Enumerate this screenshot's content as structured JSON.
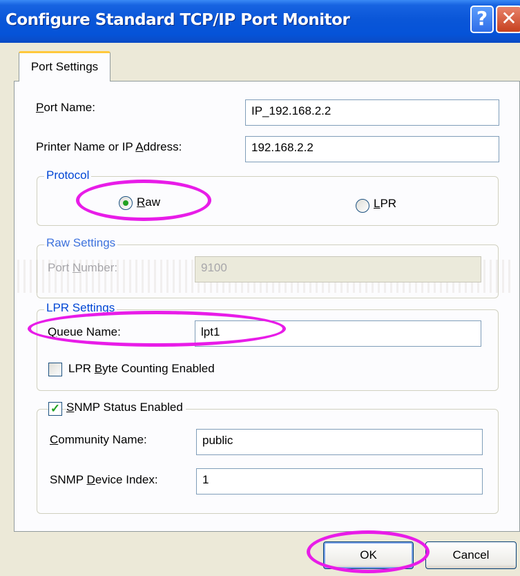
{
  "window": {
    "title": "Configure Standard TCP/IP Port Monitor",
    "help_glyph": "?",
    "close_glyph": "✕"
  },
  "tabs": [
    {
      "label": "Port Settings",
      "active": true
    }
  ],
  "fields": {
    "port_name": {
      "label_pre": "",
      "label_u": "P",
      "label_post": "ort Name:",
      "value": "IP_192.168.2.2"
    },
    "printer_address": {
      "label_pre": "Printer Name or IP ",
      "label_u": "A",
      "label_post": "ddress:",
      "value": "192.168.2.2"
    }
  },
  "protocol": {
    "legend": "Protocol",
    "raw": {
      "label_pre": "",
      "label_u": "R",
      "label_post": "aw",
      "selected": true
    },
    "lpr": {
      "label_pre": "",
      "label_u": "L",
      "label_post": "PR",
      "selected": false
    }
  },
  "raw_settings": {
    "legend": "Raw Settings",
    "port_number": {
      "label_pre": "Port ",
      "label_u": "N",
      "label_post": "umber:",
      "value": "9100",
      "disabled": true
    }
  },
  "lpr_settings": {
    "legend": "LPR Settings",
    "queue_name": {
      "label_pre": "",
      "label_u": "Q",
      "label_post": "ueue Name:",
      "value": "lpt1"
    },
    "byte_counting": {
      "label_pre": "LPR ",
      "label_u": "B",
      "label_post": "yte Counting Enabled",
      "checked": false
    }
  },
  "snmp": {
    "status_enabled": {
      "label_pre": "",
      "label_u": "S",
      "label_post": "NMP Status Enabled",
      "checked": true
    },
    "community_name": {
      "label_pre": "",
      "label_u": "C",
      "label_post": "ommunity Name:",
      "value": "public"
    },
    "device_index": {
      "label_pre": "SNMP ",
      "label_u": "D",
      "label_post": "evice Index:",
      "value": "1"
    }
  },
  "buttons": {
    "ok": "OK",
    "cancel": "Cancel"
  },
  "colors": {
    "highlight_marker": "#e81ce8",
    "group_legend": "#0046d5",
    "title_bar": "#0553d8"
  }
}
